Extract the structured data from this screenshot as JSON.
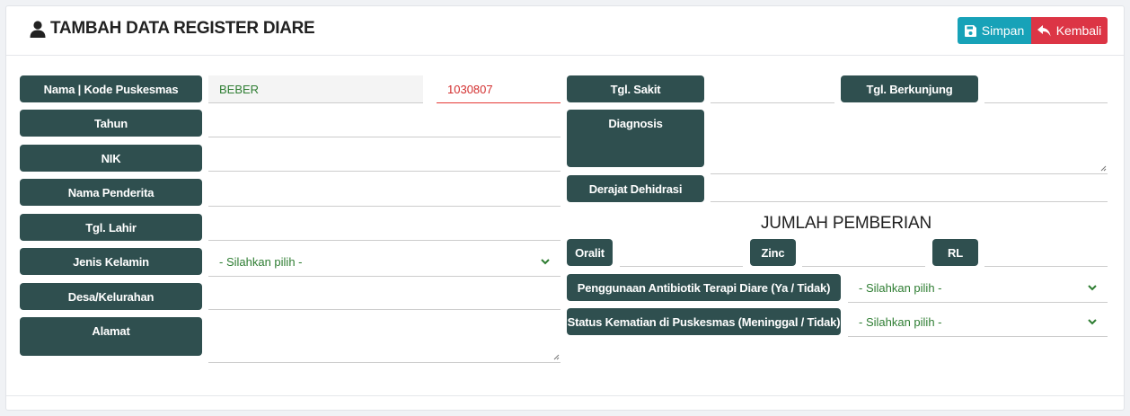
{
  "header": {
    "title": "TAMBAH DATA REGISTER DIARE",
    "simpan_label": "Simpan",
    "kembali_label": "Kembali"
  },
  "form": {
    "nama_kode_puskesmas_label": "Nama | Kode Puskesmas",
    "nama_puskesmas_value": "BEBER",
    "kode_puskesmas_value": "1030807",
    "tahun_label": "Tahun",
    "nik_label": "NIK",
    "nama_penderita_label": "Nama Penderita",
    "tgl_lahir_label": "Tgl. Lahir",
    "jenis_kelamin_label": "Jenis Kelamin",
    "jenis_kelamin_value": "- Silahkan pilih -",
    "desa_label": "Desa/Kelurahan",
    "alamat_label": "Alamat",
    "tgl_sakit_label": "Tgl. Sakit",
    "tgl_berkunjung_label": "Tgl. Berkunjung",
    "diagnosis_label": "Diagnosis",
    "derajat_dehidrasi_label": "Derajat Dehidrasi",
    "jumlah_pemberian_heading": "JUMLAH PEMBERIAN",
    "oralit_label": "Oralit",
    "zinc_label": "Zinc",
    "rl_label": "RL",
    "antibiotik_label": "Penggunaan Antibiotik Terapi Diare (Ya / Tidak)",
    "antibiotik_value": "- Silahkan pilih -",
    "status_kematian_label": "Status Kematian di Puskesmas (Meninggal / Tidak)",
    "status_kematian_value": "- Silahkan pilih -"
  },
  "colors": {
    "label_bg": "#2f4f4f",
    "simpan": "#17a2b8",
    "kembali": "#dc3545",
    "select_text": "#2e7d32"
  },
  "icons": [
    "user-icon",
    "save-icon",
    "undo-arrow-icon",
    "chevron-down-icon",
    "resize-grip-icon"
  ]
}
